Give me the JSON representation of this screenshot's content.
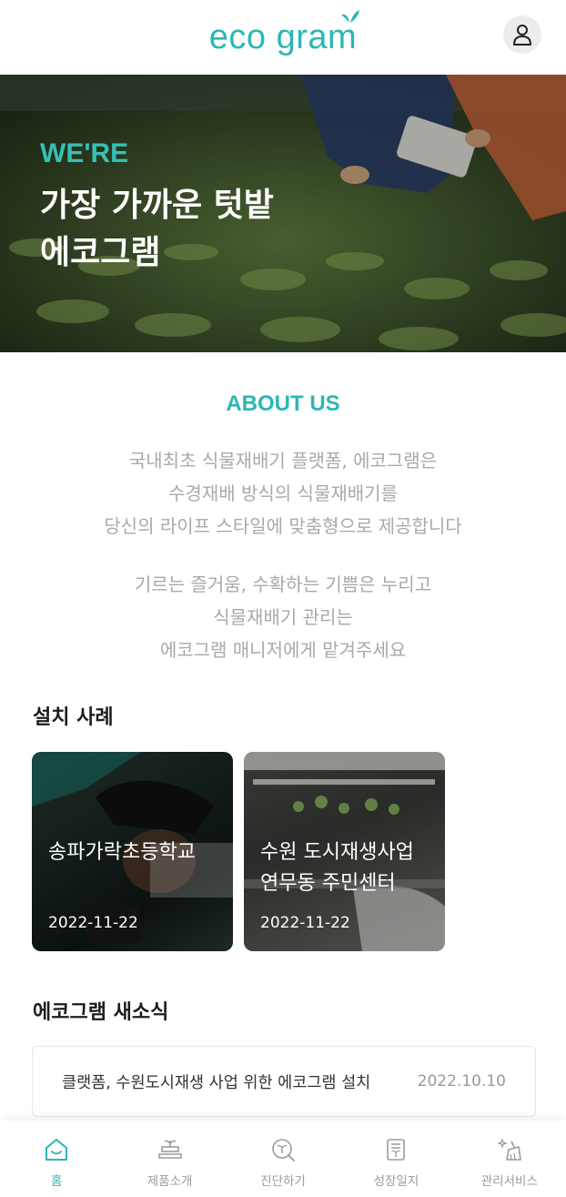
{
  "header": {
    "logo_text": "eco gram",
    "profile_icon": "user-icon"
  },
  "hero": {
    "kicker": "WE'RE",
    "title_line1": "가장 가까운 텃밭",
    "title_line2": "에코그램"
  },
  "about": {
    "title": "ABOUT US",
    "paragraph1": [
      "국내최초 식물재배기 플랫폼, 에코그램은",
      "수경재배 방식의 식물재배기를",
      "당신의 라이프 스타일에 맞춤형으로 제공합니다"
    ],
    "paragraph2": [
      "기르는 즐거움, 수확하는 기쁨은 누리고",
      "식물재배기 관리는",
      "에코그램 매니저에게 맡겨주세요"
    ]
  },
  "cases": {
    "title": "설치 사례",
    "items": [
      {
        "title": "송파가락초등학교",
        "date": "2022-11-22"
      },
      {
        "title_line1": "수원 도시재생사업",
        "title_line2": "연무동 주민센터",
        "date": "2022-11-22"
      }
    ]
  },
  "news": {
    "title": "에코그램 새소식",
    "items": [
      {
        "text": "클랫폼, 수원도시재생 사업 위한 에코그램 설치",
        "date": "2022.10.10"
      }
    ]
  },
  "tabbar": {
    "items": [
      {
        "label": "홈",
        "icon": "home-icon",
        "active": true
      },
      {
        "label": "제품소개",
        "icon": "plant-pot-icon",
        "active": false
      },
      {
        "label": "진단하기",
        "icon": "diagnose-icon",
        "active": false
      },
      {
        "label": "성장일지",
        "icon": "journal-icon",
        "active": false
      },
      {
        "label": "관리서비스",
        "icon": "cleaning-icon",
        "active": false
      }
    ]
  },
  "colors": {
    "accent": "#2bb7b3",
    "muted_text": "#a9a9a9"
  }
}
